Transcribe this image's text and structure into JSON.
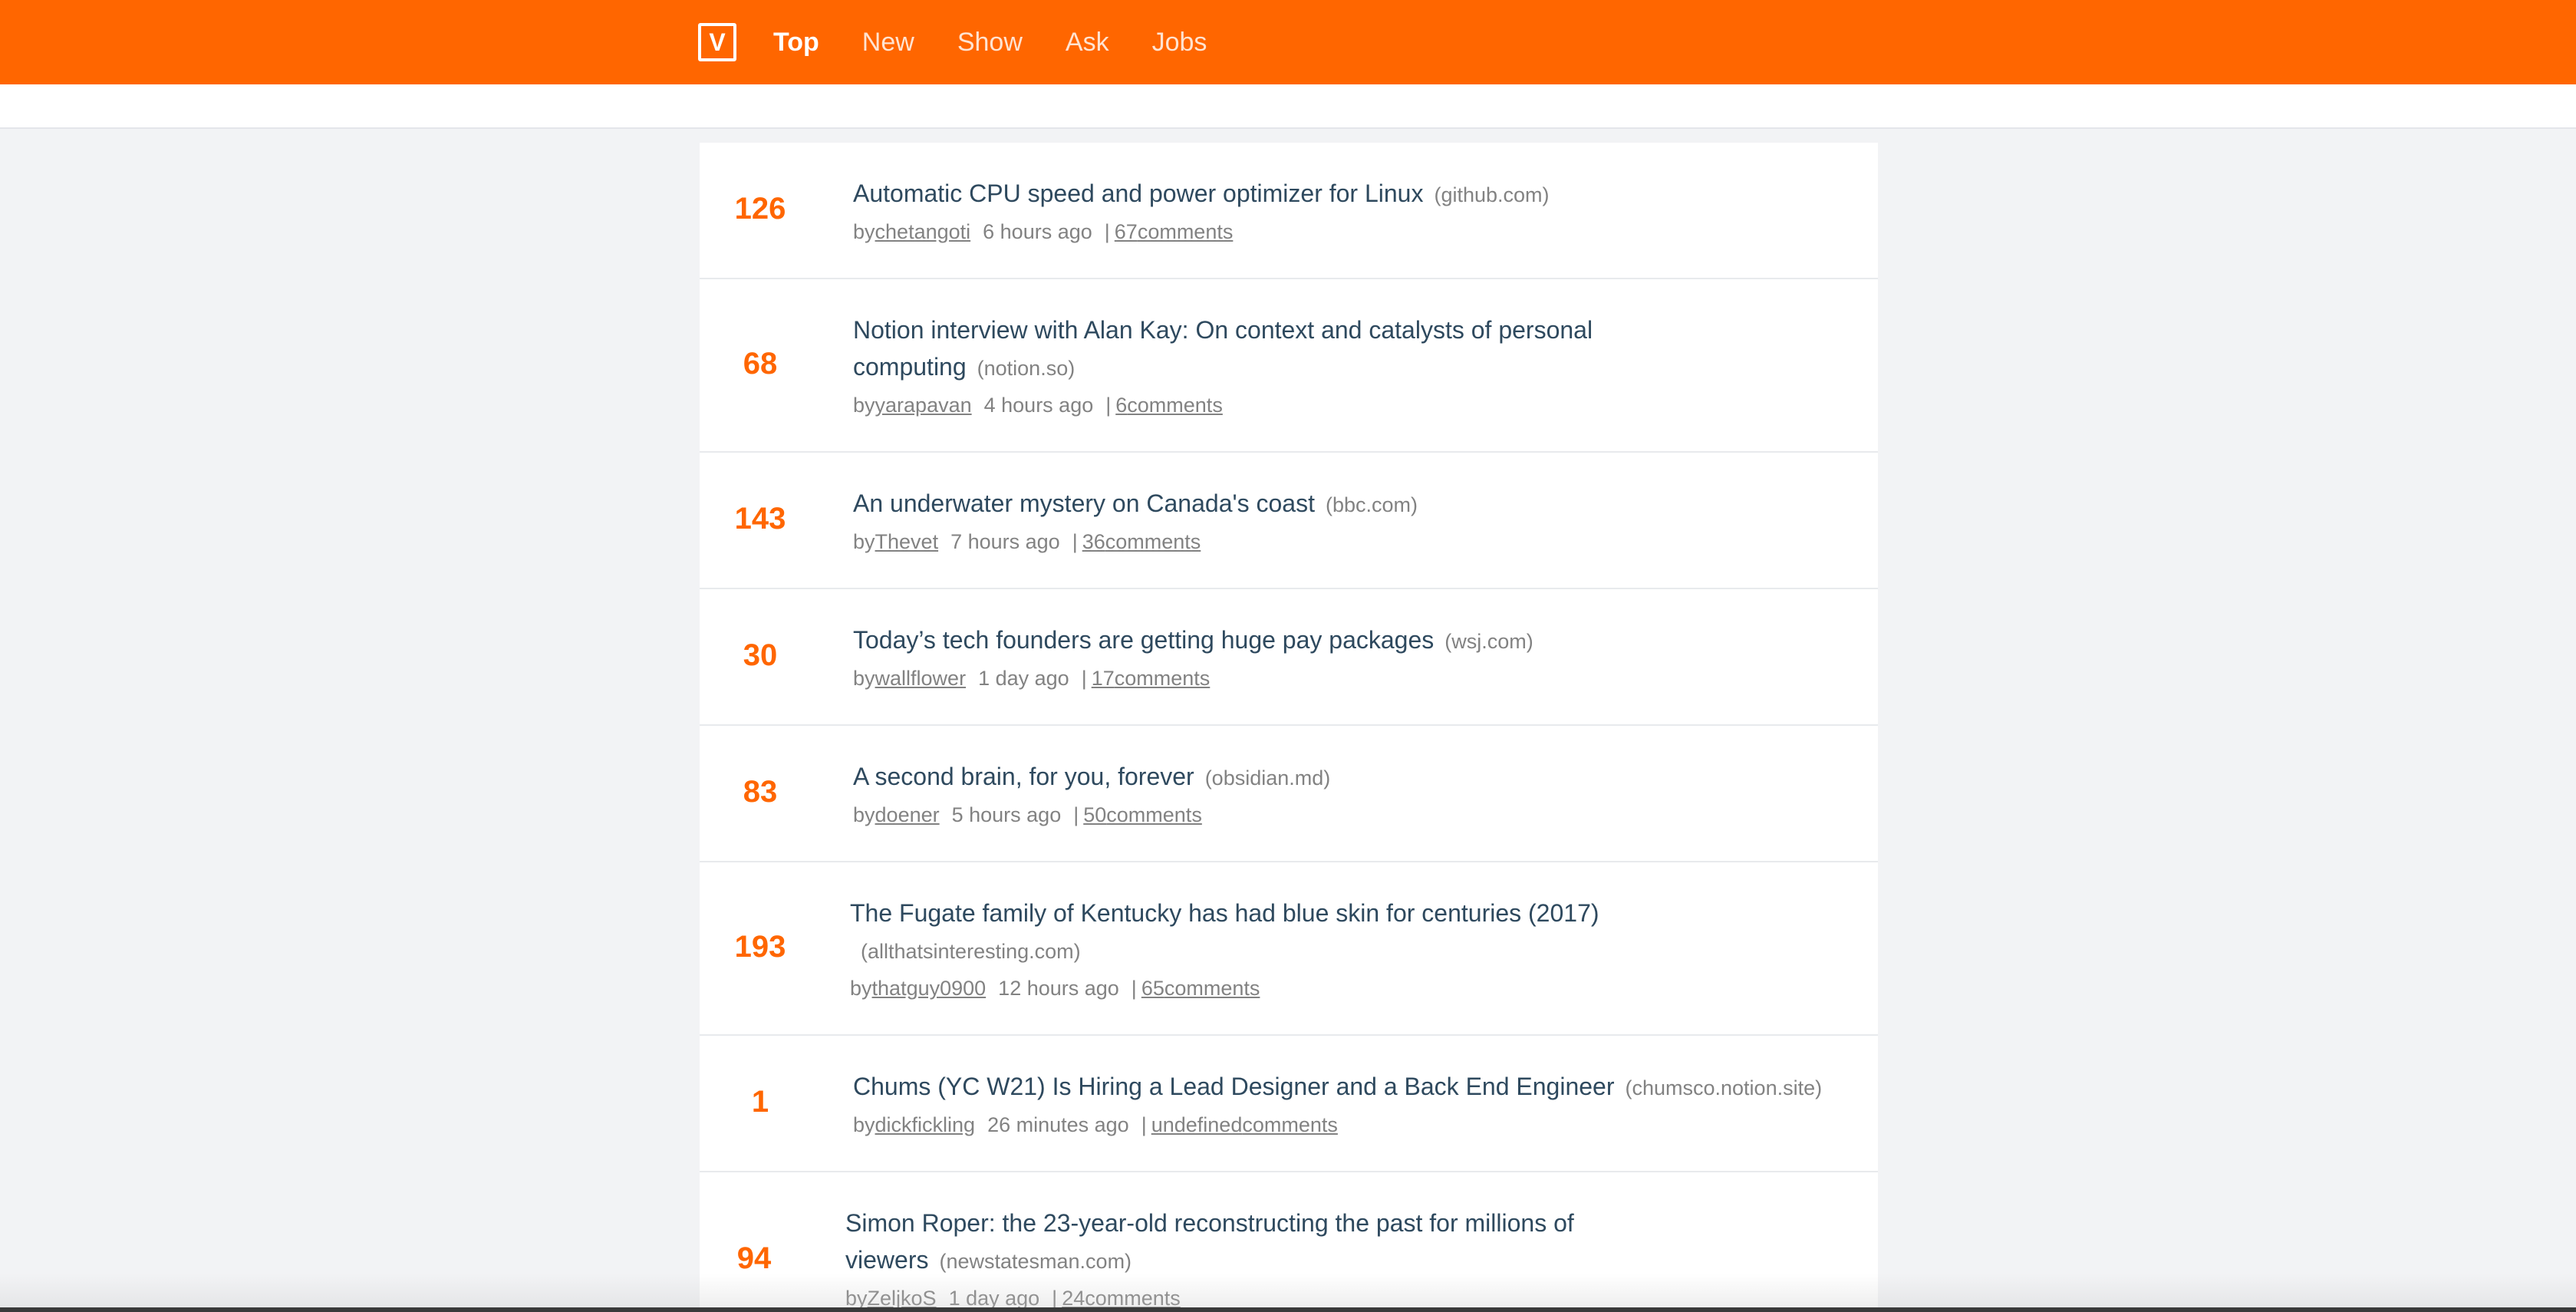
{
  "header": {
    "logo_text": "V",
    "nav": [
      {
        "label": "Top",
        "active": true
      },
      {
        "label": "New",
        "active": false
      },
      {
        "label": "Show",
        "active": false
      },
      {
        "label": "Ask",
        "active": false
      },
      {
        "label": "Jobs",
        "active": false
      }
    ],
    "accent_color": "#ff6600"
  },
  "stories": [
    {
      "score": "126",
      "title": "Automatic CPU speed and power optimizer for Linux",
      "host": "(github.com)",
      "by": "by",
      "user": "chetangoti",
      "time": "6 hours ago",
      "sep": "|",
      "comments_count": "67",
      "comments_suffix": "comments"
    },
    {
      "score": "68",
      "title": "Notion interview with Alan Kay: On context and catalysts of personal computing",
      "host": "(notion.so)",
      "by": "by",
      "user": "yarapavan",
      "time": "4 hours ago",
      "sep": "|",
      "comments_count": "6",
      "comments_suffix": "comments"
    },
    {
      "score": "143",
      "title": "An underwater mystery on Canada's coast",
      "host": "(bbc.com)",
      "by": "by",
      "user": "Thevet",
      "time": "7 hours ago",
      "sep": "|",
      "comments_count": "36",
      "comments_suffix": "comments"
    },
    {
      "score": "30",
      "title": "Today’s tech founders are getting huge pay packages",
      "host": "(wsj.com)",
      "by": "by",
      "user": "wallflower",
      "time": "1 day ago",
      "sep": "|",
      "comments_count": "17",
      "comments_suffix": "comments"
    },
    {
      "score": "83",
      "title": "A second brain, for you, forever",
      "host": "(obsidian.md)",
      "by": "by",
      "user": "doener",
      "time": "5 hours ago",
      "sep": "|",
      "comments_count": "50",
      "comments_suffix": "comments"
    },
    {
      "score": "193",
      "title": "The Fugate family of Kentucky has had blue skin for centuries (2017)",
      "host": "(allthatsinteresting.com)",
      "by": "by",
      "user": "thatguy0900",
      "time": "12 hours ago",
      "sep": "|",
      "comments_count": "65",
      "comments_suffix": "comments"
    },
    {
      "score": "1",
      "title": "Chums (YC W21) Is Hiring a Lead Designer and a Back End Engineer",
      "host": "(chumsco.notion.site)",
      "by": "by",
      "user": "dickfickling",
      "time": "26 minutes ago",
      "sep": "|",
      "comments_count": "undefined",
      "comments_suffix": "comments"
    },
    {
      "score": "94",
      "title": "Simon Roper: the 23-year-old reconstructing the past for millions of viewers",
      "host": "(newstatesman.com)",
      "by": "by",
      "user": "ZeljkoS",
      "time": "1 day ago",
      "sep": "|",
      "comments_count": "24",
      "comments_suffix": "comments"
    }
  ]
}
